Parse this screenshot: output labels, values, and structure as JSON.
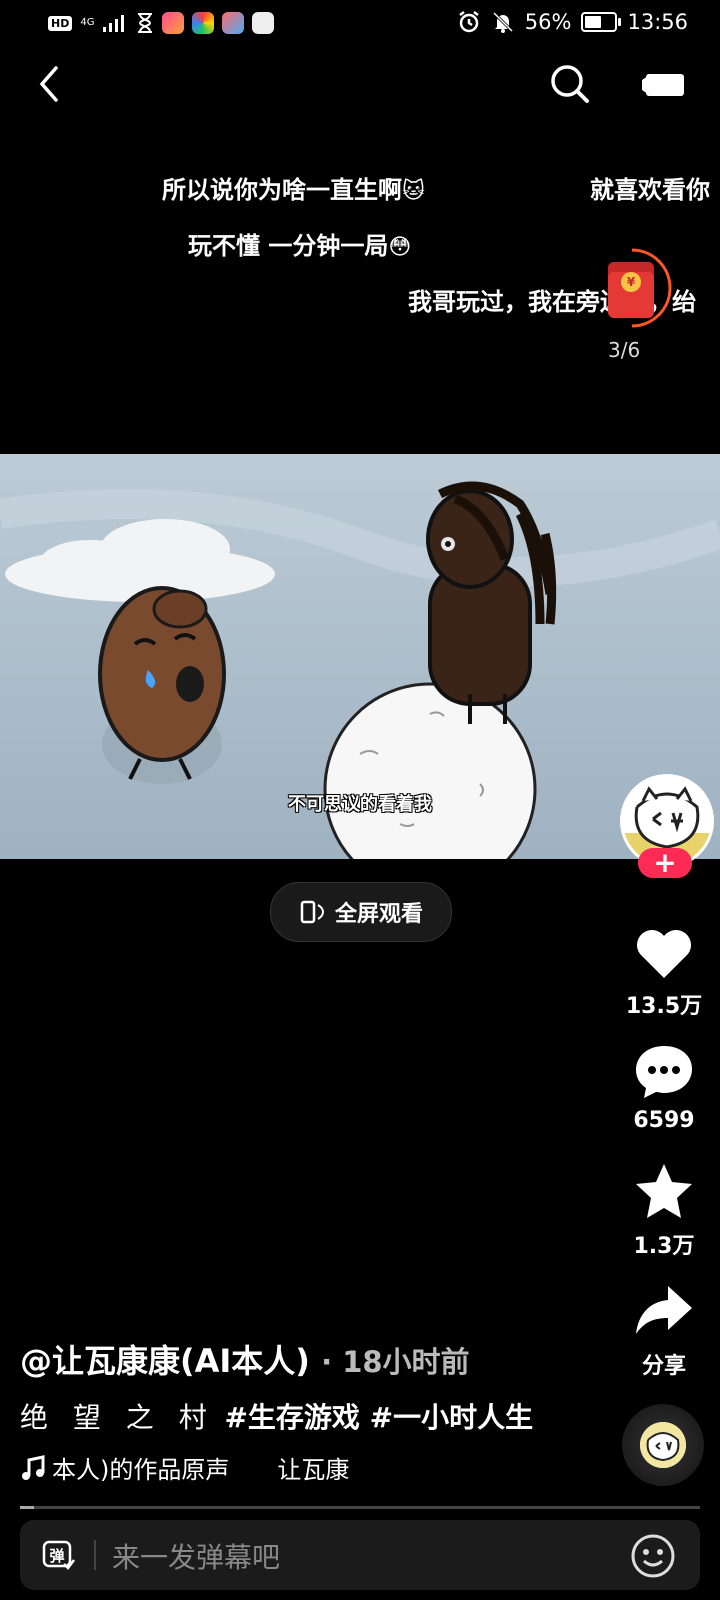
{
  "status_bar": {
    "hd": "HD",
    "network": "4G",
    "battery": "56%",
    "battery_level": 0.56,
    "time": "13:56"
  },
  "danmaku": [
    {
      "text": "所以说你为啥一直生啊",
      "emoji": "🐱"
    },
    {
      "text": "就喜欢看你"
    },
    {
      "text": "玩不懂 一分钟一局",
      "emoji": "😳"
    },
    {
      "text": "我哥玩过，我在旁边看，绐"
    }
  ],
  "red_packet": {
    "count": "3/6",
    "progress": 0.5
  },
  "video": {
    "subtitle": "不可思议的看着我"
  },
  "fullscreen_label": "全屏观看",
  "right_rail": {
    "like_count": "13.5万",
    "comment_count": "6599",
    "favorite_count": "1.3万",
    "share_label": "分享",
    "follow_label": "+"
  },
  "post": {
    "author": "@让瓦康康(AI本人)",
    "time": "· 18小时前",
    "desc_plain": "绝 望 之 村",
    "hashtags": [
      "#生存游戏",
      "#一小时人生"
    ],
    "music": "本人)的作品原声　　让瓦康",
    "progress": 0.02
  },
  "comment_bar": {
    "danmu_icon_label": "弹",
    "placeholder": "来一发弹幕吧"
  }
}
